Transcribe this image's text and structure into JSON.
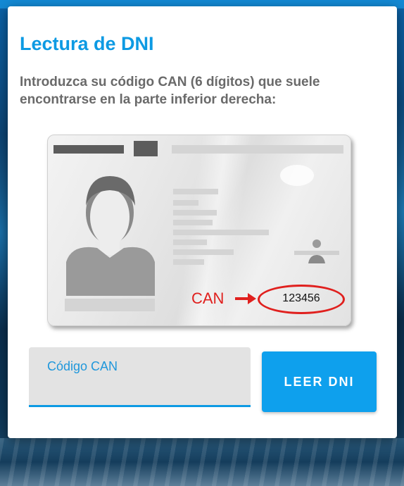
{
  "dialog": {
    "title": "Lectura de DNI",
    "instructions": "Introduzca su código CAN (6 dígitos) que suele encontrarse en la parte inferior derecha:"
  },
  "card_illustration": {
    "can_label": "CAN",
    "arrow": "→",
    "can_number": "123456",
    "highlight_color": "#e0201e"
  },
  "form": {
    "can_input_value": "",
    "can_input_placeholder": "Código CAN",
    "read_button_label": "LEER DNI"
  },
  "colors": {
    "accent": "#0d9ae3",
    "button": "#0ea0ed",
    "text_muted": "#6a6a6a"
  }
}
